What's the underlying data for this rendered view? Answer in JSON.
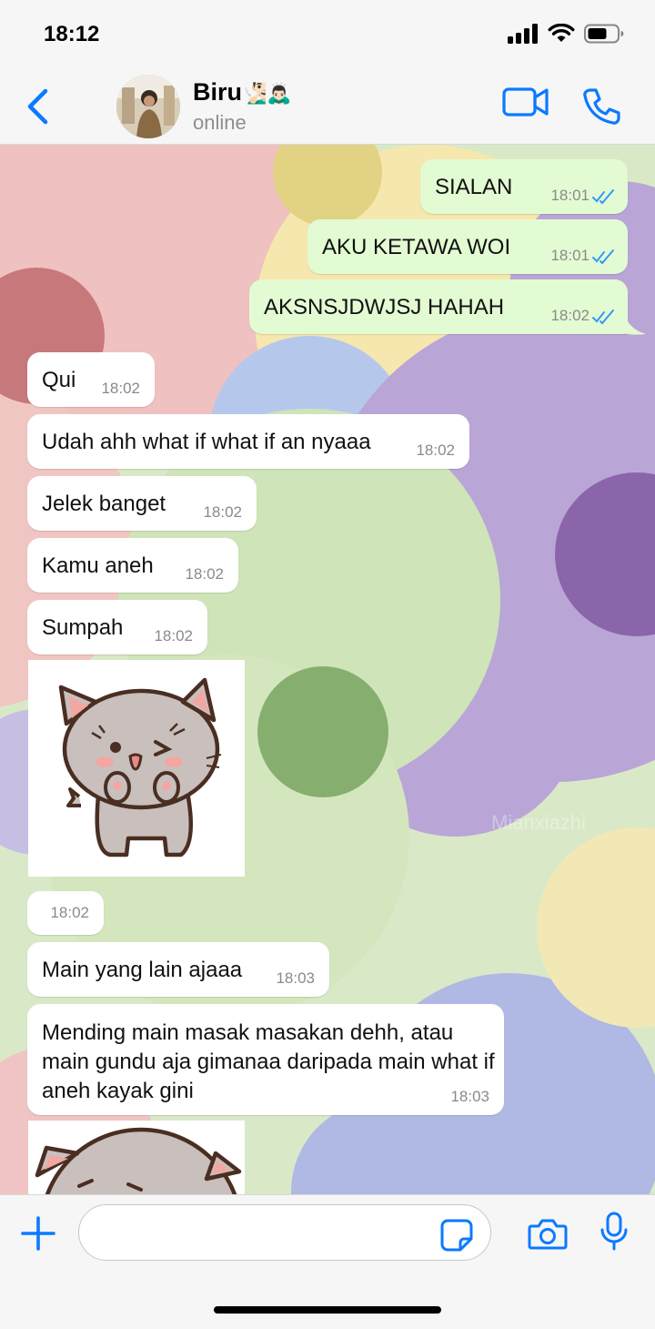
{
  "status_bar": {
    "time": "18:12"
  },
  "header": {
    "name": "Biru",
    "emoji": "🧏🏻‍♂️🙇🏻‍♂️",
    "status": "online"
  },
  "messages": [
    {
      "text": "SIALAN",
      "time": "18:01"
    },
    {
      "text": "AKU KETAWA WOI",
      "time": "18:01"
    },
    {
      "text": "AKSNSJDWJSJ HAHAH",
      "time": "18:02"
    },
    {
      "text": "Qui",
      "time": "18:02"
    },
    {
      "text": "Udah ahh what if what if an nyaaa",
      "time": "18:02"
    },
    {
      "text": "Jelek banget",
      "time": "18:02"
    },
    {
      "text": "Kamu aneh",
      "time": "18:02"
    },
    {
      "text": "Sumpah",
      "time": "18:02"
    },
    {
      "text": "",
      "time": "18:02"
    },
    {
      "text": "Main yang lain ajaaa",
      "time": "18:03"
    },
    {
      "text": "Mending main masak masakan dehh, atau main gundu aja gimanaa daripada main what if aneh kayak gini",
      "time": "18:03"
    }
  ],
  "watermark": "Mianxiazhi",
  "colors": {
    "accent": "#0a7aff",
    "outgoing_bubble": "#e3fbd3",
    "incoming_bubble": "#ffffff",
    "read_ticks": "#3497f9"
  }
}
